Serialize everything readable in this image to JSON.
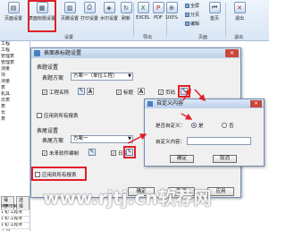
{
  "ribbon": {
    "buttons": [
      {
        "label": "页面设置",
        "icon": "page-setup-icon"
      },
      {
        "label": "表面标题设置",
        "icon": "header-setup-icon"
      },
      {
        "label": "页脚设置",
        "icon": "footer-setup-icon"
      },
      {
        "label": "打印设置",
        "icon": "print-setup-icon"
      },
      {
        "label": "水印设置",
        "icon": "watermark-icon"
      },
      {
        "label": "刷新",
        "icon": "refresh-icon"
      },
      {
        "label": "EXCEL",
        "icon": "excel-icon"
      },
      {
        "label": "PDF",
        "icon": "pdf-icon"
      },
      {
        "label": "100%",
        "icon": "zoom-icon"
      },
      {
        "label": "首页",
        "icon": "first-page-icon"
      },
      {
        "label": "退出",
        "icon": "exit-icon"
      }
    ],
    "mini": [
      "全屏",
      "分页",
      "编辑"
    ],
    "groups": [
      "设置",
      "导出",
      "页面",
      "退出"
    ]
  },
  "left_list": {
    "items": [
      "工程",
      "工程",
      "",
      "",
      "",
      "",
      "",
      "管理表",
      "管理表",
      "测量",
      "项",
      "测量",
      "表",
      "机具",
      "员表",
      "表",
      "长",
      "表"
    ],
    "buttons": [
      "保存",
      "选择"
    ],
    "rows": [
      "项目组编",
      "1 初 工程项",
      "1 初 工程项",
      "1 初 工程项",
      "工 设"
    ]
  },
  "dialog": {
    "title": "表面表标题设置",
    "close": "✕",
    "header_section": "表题设置",
    "header_scheme_label": "表题方案",
    "header_scheme_value": "方案一（单位工程）",
    "cb_project_name": "工程名称",
    "cb_title": "标题",
    "cb_page": "页码",
    "cb_apply_all_header": "应用到所有报表",
    "footer_section": "表尾设置",
    "footer_scheme_label": "表尾方案",
    "footer_scheme_value": "方案一",
    "cb_software": "未来软件编制",
    "cb_date": "日期",
    "cb_apply_all_footer": "应用到所有报表",
    "ok": "确定",
    "cancel": "取消",
    "apply": "应用"
  },
  "subdialog": {
    "title": "自定义内容",
    "close": "✕",
    "question": "是否自定义：",
    "yes": "是",
    "no": "否",
    "content_label": "自定义内容：",
    "content_value": "",
    "ok": "确定",
    "cancel": "取消"
  },
  "watermark": "www.rjtj.cn软荐网",
  "colors": {
    "highlight": "#e0202a",
    "accent": "#4a7ec2"
  }
}
